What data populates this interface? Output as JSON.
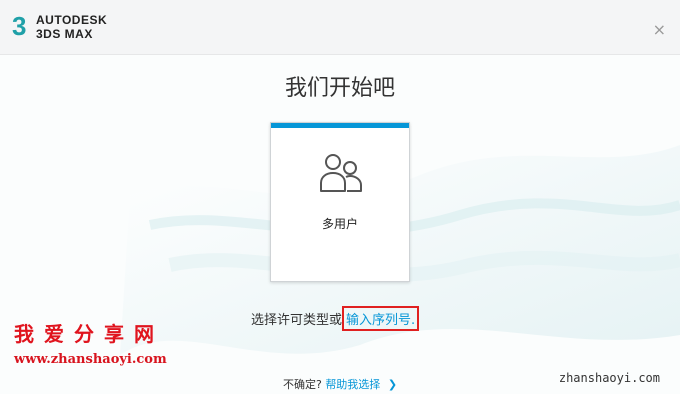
{
  "brand": {
    "line1": "AUTODESK",
    "line2": "3DS MAX",
    "mark": "3"
  },
  "window": {
    "close_glyph": "×"
  },
  "main": {
    "heading": "我们开始吧",
    "card": {
      "label": "多用户",
      "icon": "users-icon"
    },
    "prompt_text": "选择许可类型或",
    "serial_link": "输入序列号."
  },
  "footer": {
    "unsure": "不确定?",
    "help_link": "帮助我选择",
    "chevron": "❯"
  },
  "watermark": {
    "title": "我爱分享网",
    "url": "www.zhanshaoyi.com",
    "right": "zhanshaoyi.com"
  },
  "colors": {
    "accent": "#0696d7",
    "teal": "#1fa0a8",
    "highlight": "#e02020"
  }
}
